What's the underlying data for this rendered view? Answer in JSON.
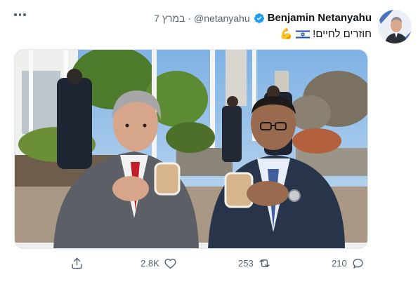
{
  "tweet": {
    "author_name": "Benjamin Netanyahu",
    "handle": "@netanyahu",
    "separator": "·",
    "date": "7 במרץ",
    "text": "חוזרים לחיים!",
    "verified_icon": "verified-badge-icon",
    "emoji": [
      "israel-flag-icon",
      "flexed-biceps-icon"
    ]
  },
  "actions": {
    "share_icon": "share-icon",
    "likes": "2.8K",
    "retweets": "253",
    "replies": "210"
  },
  "colors": {
    "verified": "#1d9bf0",
    "secondary_text": "#536471",
    "primary_text": "#0f1419"
  }
}
